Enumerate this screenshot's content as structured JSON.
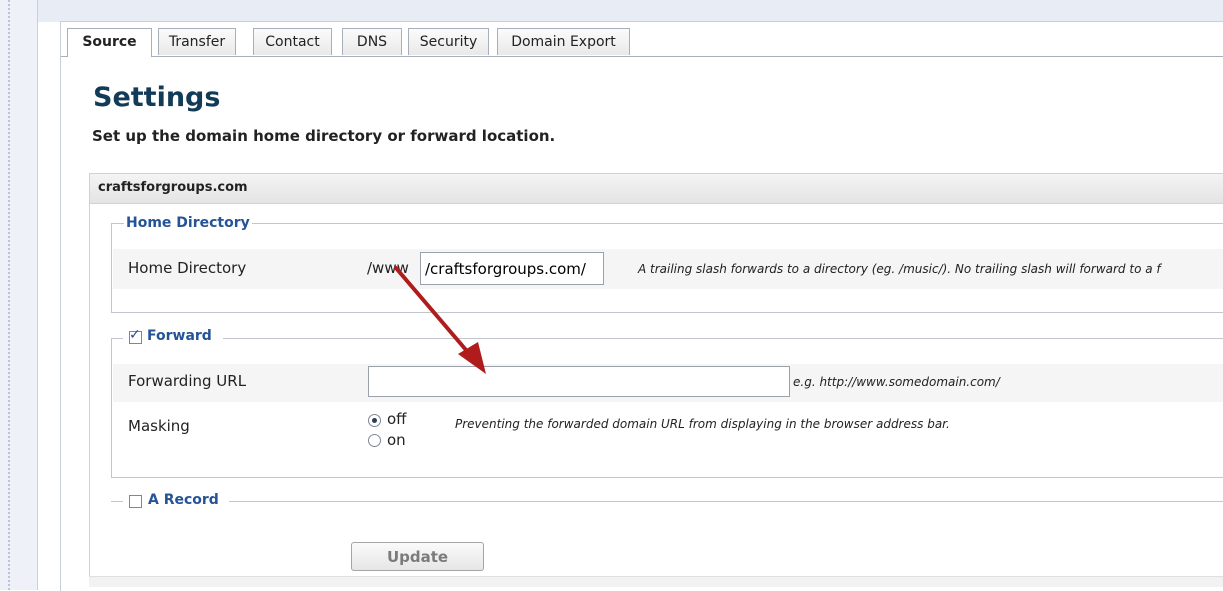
{
  "tabs": [
    {
      "label": "Source",
      "active": true
    },
    {
      "label": "Transfer",
      "active": false
    },
    {
      "label": "Contact",
      "active": false
    },
    {
      "label": "DNS",
      "active": false
    },
    {
      "label": "Security",
      "active": false
    },
    {
      "label": "Domain Export",
      "active": false
    }
  ],
  "page": {
    "title": "Settings",
    "subtitle": "Set up the domain home directory or forward location."
  },
  "domain": "craftsforgroups.com",
  "home_directory": {
    "legend": "Home Directory",
    "label": "Home Directory",
    "prefix": "/www",
    "value": "/craftsforgroups.com/",
    "hint": "A trailing slash forwards to a directory (eg. /music/). No trailing slash will forward to a f"
  },
  "forward": {
    "legend": "Forward",
    "checked": true,
    "url_label": "Forwarding URL",
    "url_value": "",
    "url_hint": "e.g. http://www.somedomain.com/",
    "masking_label": "Masking",
    "masking_options": [
      "off",
      "on"
    ],
    "masking_selected": "off",
    "masking_hint": "Preventing the forwarded domain URL from displaying in the browser address bar."
  },
  "a_record": {
    "legend": "A Record",
    "checked": false
  },
  "update_label": "Update",
  "colors": {
    "title": "#123b57",
    "legend": "#245497",
    "arrow": "#b01c1c"
  }
}
